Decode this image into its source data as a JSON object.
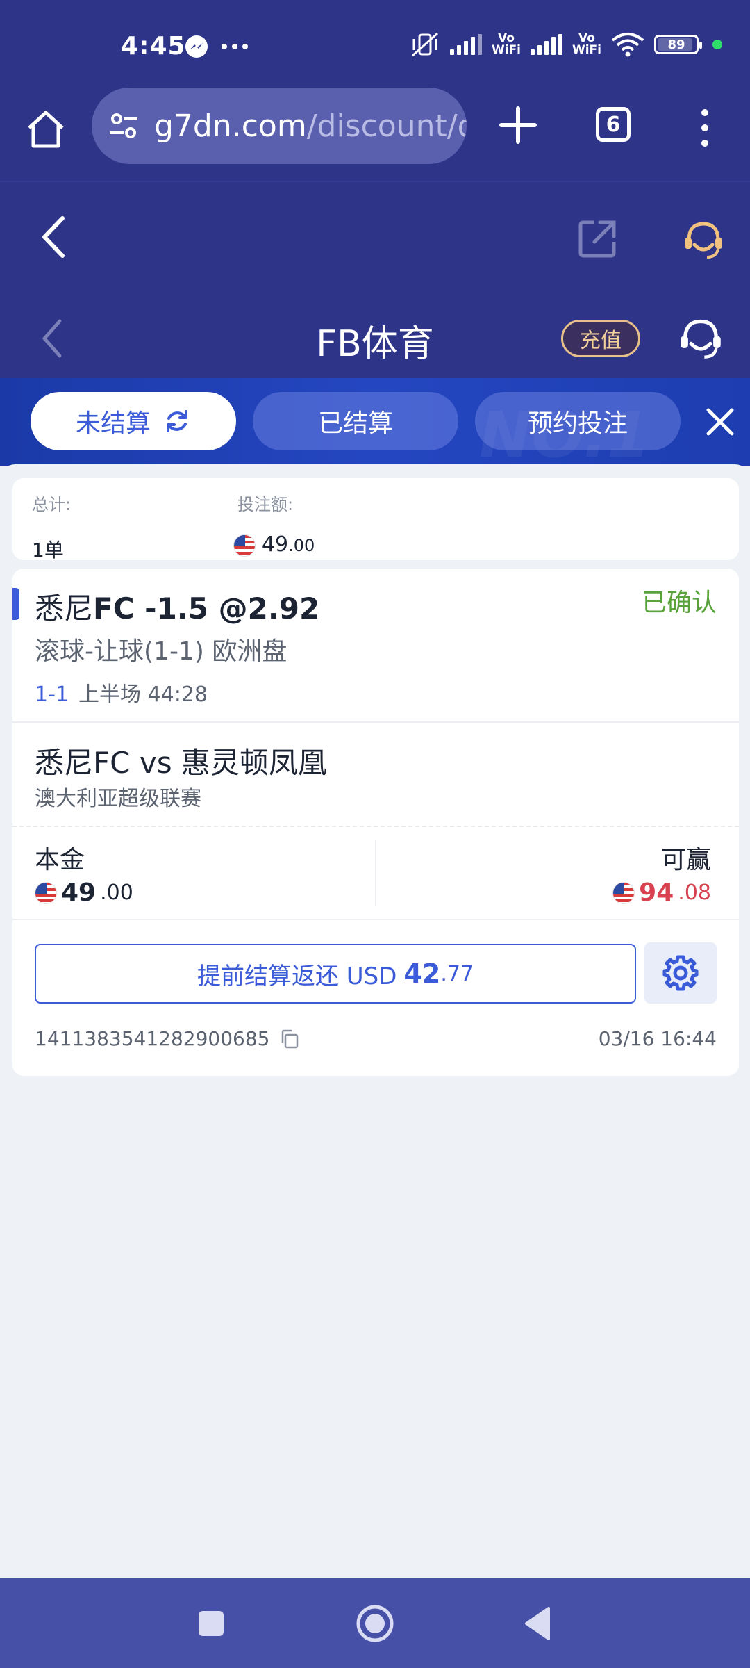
{
  "status_bar": {
    "time": "4:45",
    "vowifi_top": "Vo",
    "vowifi_bottom": "WiFi",
    "battery": "89"
  },
  "browser": {
    "url_host": "g7dn.com",
    "url_path": "/discount/dis",
    "tab_count": "6"
  },
  "fb_header": {
    "title": "FB体育",
    "recharge_label": "充值"
  },
  "tabs": [
    {
      "label": "未结算"
    },
    {
      "label": "已结算"
    },
    {
      "label": "预约投注"
    }
  ],
  "tab_watermark": "NO.1",
  "summary": {
    "total_label": "总计:",
    "total_value": "1单",
    "stake_label": "投注额:",
    "stake_int": "49",
    "stake_dec": ".00"
  },
  "bet": {
    "selection_prefix": "悉尼",
    "selection_bold": "FC -1.5 @2.92",
    "status": "已确认",
    "market": "滚球-让球(1-1) 欧洲盘",
    "live_score": "1-1",
    "live_time": "上半场 44:28",
    "match": "悉尼FC vs 惠灵顿凤凰",
    "league": "澳大利亚超级联赛",
    "stake_label": "本金",
    "stake_int": "49",
    "stake_dec": ".00",
    "win_label": "可赢",
    "win_int": "94",
    "win_dec": ".08",
    "cashout_prefix": "提前结算返还 USD",
    "cashout_int": "42",
    "cashout_dec": ".77",
    "order_id": "1411383541282900685",
    "order_time": "03/16 16:44"
  },
  "colors": {
    "header_bg": "#2e3488",
    "accent": "#3b5bd9",
    "confirmed": "#5aa33c",
    "win": "#d84250",
    "recharge_gold": "#f3cf9c"
  }
}
